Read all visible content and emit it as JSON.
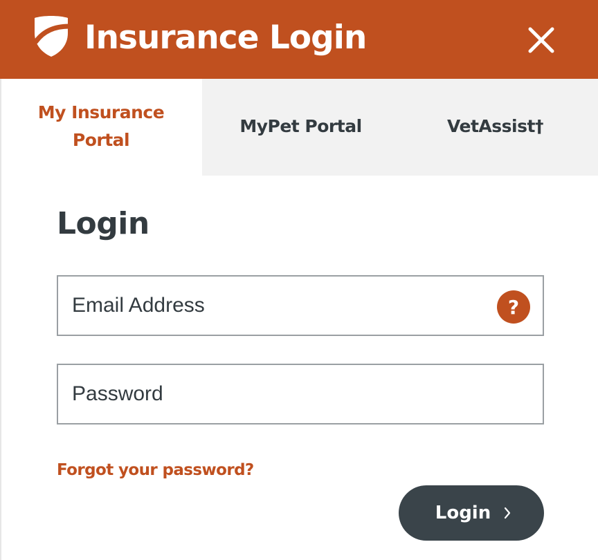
{
  "colors": {
    "brand": "#c0501f",
    "text_dark": "#333b40",
    "button_bg": "#3a444a",
    "tab_inactive_bg": "#f2f2f2"
  },
  "header": {
    "title": "Insurance Login",
    "logo_icon": "shield-logo-icon",
    "close_icon": "close-icon"
  },
  "tabs": [
    {
      "label": "My Insurance Portal",
      "active": true
    },
    {
      "label": "MyPet Portal",
      "active": false
    },
    {
      "label": "VetAssist†",
      "active": false
    }
  ],
  "form": {
    "heading": "Login",
    "email": {
      "placeholder": "Email Address",
      "value": "",
      "help_label": "?"
    },
    "password": {
      "placeholder": "Password",
      "value": ""
    },
    "forgot_link": "Forgot your password?",
    "submit_label": "Login",
    "submit_icon": "chevron-right-icon"
  }
}
